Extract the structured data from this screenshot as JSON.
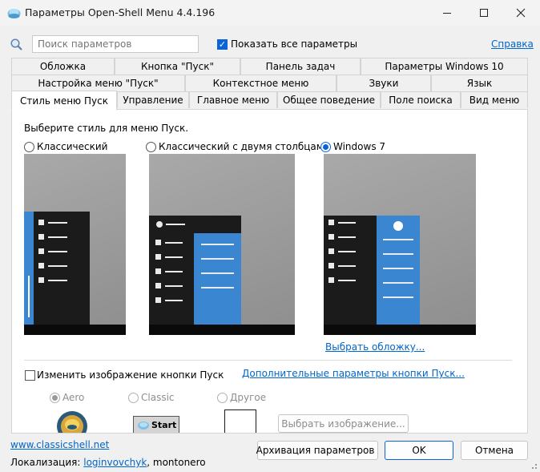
{
  "window": {
    "title": "Параметры Open-Shell Menu 4.4.196",
    "minimize_icon": "minimize-icon",
    "maximize_icon": "maximize-icon",
    "close_icon": "close-icon"
  },
  "search": {
    "placeholder": "Поиск параметров",
    "value": ""
  },
  "show_all": {
    "label": "Показать все параметры",
    "checked": true
  },
  "help_link": "Справка",
  "tabs": {
    "row1": [
      "Обложка",
      "Кнопка \"Пуск\"",
      "Панель задач",
      "Параметры Windows 10"
    ],
    "row2": [
      "Настройка меню \"Пуск\"",
      "Контекстное меню",
      "Звуки",
      "Язык"
    ],
    "row3": [
      "Стиль меню Пуск",
      "Управление",
      "Главное меню",
      "Общее поведение",
      "Поле поиска",
      "Вид меню"
    ],
    "active": "Стиль меню Пуск"
  },
  "panel": {
    "prompt": "Выберите стиль для меню Пуск.",
    "styles": [
      {
        "label": "Классический",
        "selected": false
      },
      {
        "label": "Классический с двумя столбцами",
        "selected": false
      },
      {
        "label": "Windows 7",
        "selected": true
      }
    ],
    "choose_skin_link": "Выбрать обложку...",
    "change_button_image": {
      "label": "Изменить изображение кнопки Пуск",
      "checked": false
    },
    "button_params_link": "Дополнительные параметры кнопки Пуск...",
    "button_styles": [
      {
        "label": "Aero",
        "selected": true
      },
      {
        "label": "Classic",
        "selected": false
      },
      {
        "label": "Другое",
        "selected": false
      }
    ],
    "classic_button_text": "Start",
    "choose_image_button": "Выбрать изображение..."
  },
  "footer": {
    "site_link": "www.classicshell.net",
    "localization_prefix": "Локализация:",
    "localization_author1": "loginvovchyk",
    "localization_author2": ", montonero",
    "archive_button": "Архивация параметров",
    "ok_button": "OK",
    "cancel_button": "Отмена"
  },
  "colors": {
    "accent": "#0a64d8",
    "preview_blue": "#3b86d0",
    "preview_dark": "#1b1b1b"
  }
}
